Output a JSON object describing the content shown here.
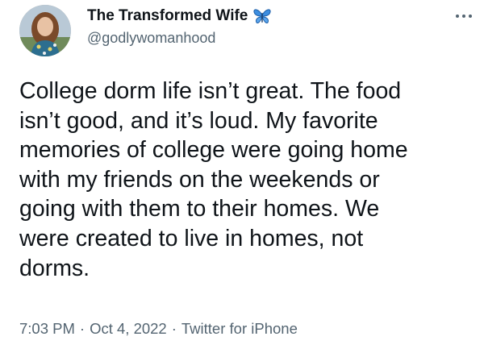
{
  "author": {
    "display_name": "The Transformed Wife",
    "handle": "@godlywomanhood",
    "badge_icon": "butterfly-icon",
    "badge_color": "#2f7fd6"
  },
  "tweet": {
    "lines": [
      "College dorm life isn’t great. The food",
      "isn’t good, and it’s loud. My favorite",
      "memories of college were going home",
      "with my friends on the weekends or",
      "going with them to their homes. We",
      "were created to live in homes, not",
      "dorms."
    ]
  },
  "meta": {
    "time": "7:03 PM",
    "date": "Oct 4, 2022",
    "source": "Twitter for iPhone",
    "separator": "·"
  },
  "colors": {
    "text": "#0f1419",
    "secondary": "#536471"
  }
}
